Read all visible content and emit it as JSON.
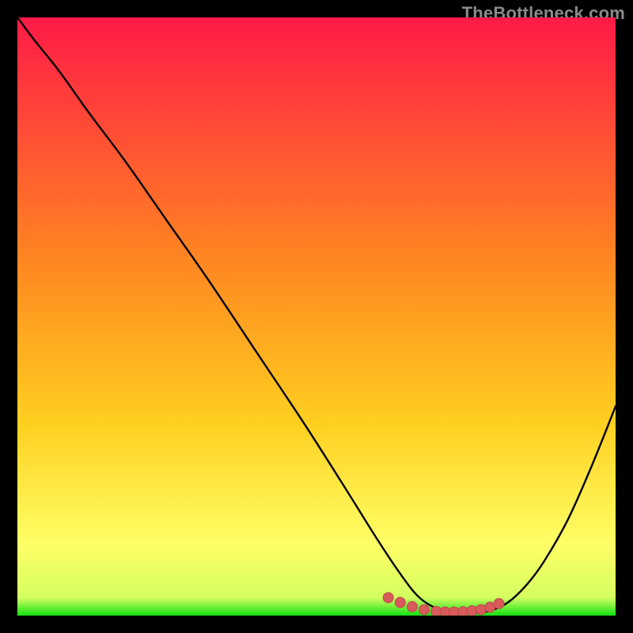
{
  "watermark": "TheBottleneck.com",
  "colors": {
    "background": "#000000",
    "gradient_top": "#ff1a47",
    "gradient_mid": "#ffd020",
    "gradient_low": "#ffff66",
    "gradient_bottom": "#14e014",
    "curve": "#000000",
    "marker_fill": "#d85a5a",
    "marker_stroke": "#bd4a4a"
  },
  "chart_data": {
    "type": "line",
    "title": "",
    "xlabel": "",
    "ylabel": "",
    "xlim": [
      0,
      100
    ],
    "ylim": [
      0,
      100
    ],
    "series": [
      {
        "name": "bottleneck-curve",
        "x": [
          0,
          3,
          7,
          12,
          18,
          25,
          32,
          40,
          48,
          55,
          60,
          64,
          67,
          70,
          73,
          76,
          79,
          82,
          85,
          88,
          92,
          96,
          100
        ],
        "y": [
          100,
          96,
          91,
          84,
          76,
          66,
          56,
          44,
          32,
          21,
          13,
          7,
          3.2,
          1.2,
          0.4,
          0.4,
          0.8,
          2.2,
          5,
          9,
          16,
          25,
          35
        ]
      }
    ],
    "markers": {
      "name": "highlighted-points",
      "x": [
        62,
        64,
        66,
        68,
        70,
        71.5,
        73,
        74.5,
        76,
        77.5,
        79,
        80.5
      ],
      "y": [
        3.0,
        2.2,
        1.5,
        1.0,
        0.7,
        0.6,
        0.6,
        0.65,
        0.8,
        1.0,
        1.4,
        2.0
      ]
    }
  }
}
